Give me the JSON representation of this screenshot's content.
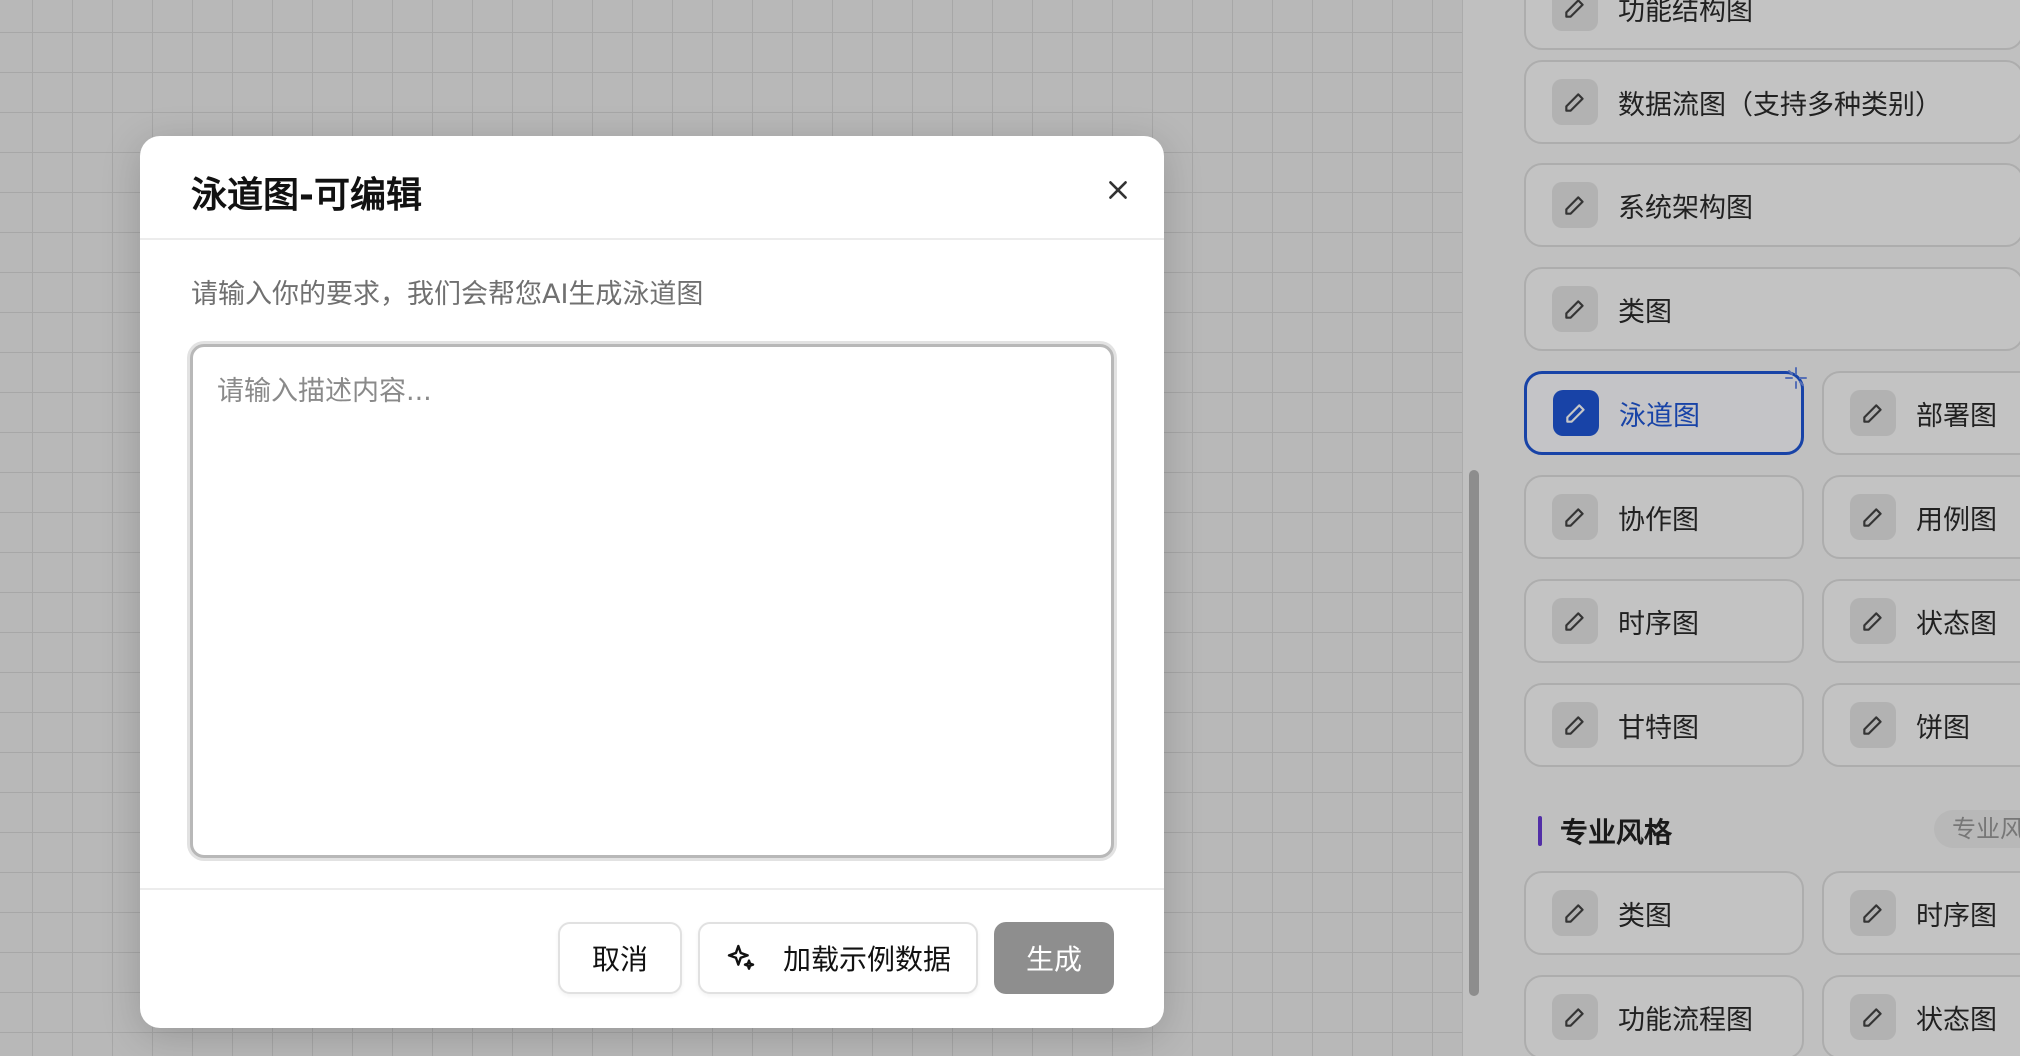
{
  "modal": {
    "title": "泳道图-可编辑",
    "description": "请输入你的要求，我们会帮您AI生成泳道图",
    "input_placeholder": "请输入描述内容...",
    "input_value": "",
    "cancel_label": "取消",
    "load_sample_label": "加载示例数据",
    "generate_label": "生成"
  },
  "panel": {
    "cards": [
      {
        "label": "功能结构图"
      },
      {
        "label": "数据流图（支持多种类别）"
      },
      {
        "label": "系统架构图"
      },
      {
        "label": "类图"
      },
      {
        "label": "泳道图",
        "active": true
      },
      {
        "label": "部署图"
      },
      {
        "label": "协作图"
      },
      {
        "label": "用例图"
      },
      {
        "label": "时序图"
      },
      {
        "label": "状态图"
      },
      {
        "label": "甘特图"
      },
      {
        "label": "饼图"
      }
    ],
    "section": {
      "title": "专业风格",
      "chip": "专业风格"
    },
    "pro_cards": [
      {
        "label": "类图"
      },
      {
        "label": "时序图"
      },
      {
        "label": "功能流程图"
      },
      {
        "label": "状态图"
      }
    ]
  },
  "colors": {
    "accent": "#1f57d6",
    "section_bar": "#6a3cd6",
    "generate_button": "#8e8e8e"
  },
  "icons": {
    "card": "pencil-icon",
    "close": "close-icon",
    "sample": "sparkle-icon"
  }
}
